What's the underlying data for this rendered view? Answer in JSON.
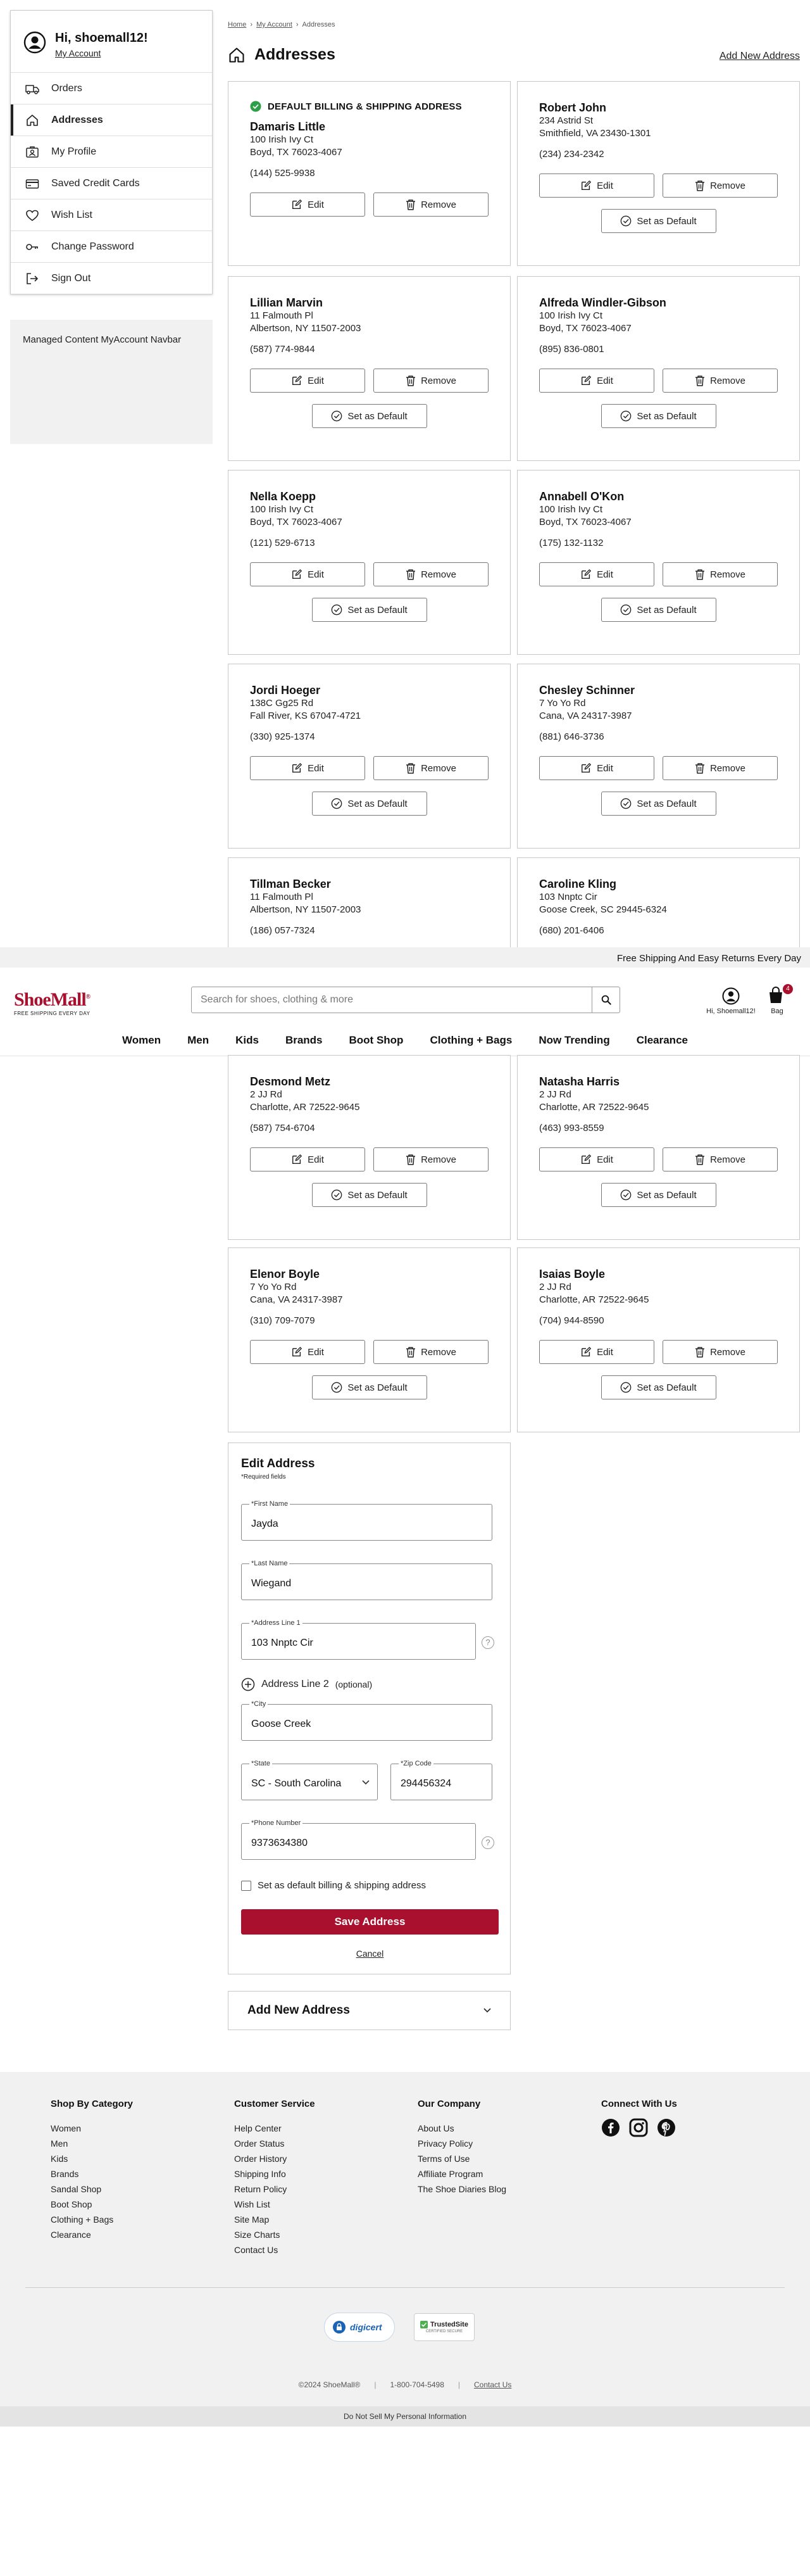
{
  "account": {
    "greeting": "Hi, shoemall12!",
    "my_account_link": "My Account",
    "menu": [
      {
        "label": "Orders",
        "icon": "truck-icon",
        "active": false
      },
      {
        "label": "Addresses",
        "icon": "home-icon",
        "active": true
      },
      {
        "label": "My Profile",
        "icon": "profile-icon",
        "active": false
      },
      {
        "label": "Saved Credit Cards",
        "icon": "credit-card-icon",
        "active": false
      },
      {
        "label": "Wish List",
        "icon": "heart-icon",
        "active": false
      },
      {
        "label": "Change Password",
        "icon": "key-icon",
        "active": false
      },
      {
        "label": "Sign Out",
        "icon": "sign-out-icon",
        "active": false
      }
    ],
    "managed_content": "Managed Content MyAccount Navbar"
  },
  "breadcrumb": [
    "Home",
    "My Account",
    "Addresses"
  ],
  "page": {
    "title": "Addresses",
    "add_new_link": "Add New Address"
  },
  "default_label": "DEFAULT BILLING & SHIPPING ADDRESS",
  "labels": {
    "edit": "Edit",
    "remove": "Remove",
    "set_default": "Set as Default"
  },
  "addresses": [
    {
      "name": "Damaris Little",
      "line1": "100 Irish Ivy Ct",
      "line2": "Boyd, TX 76023-4067",
      "phone": "(144) 525-9938",
      "is_default": true
    },
    {
      "name": "Robert John",
      "line1": "234 Astrid St",
      "line2": "Smithfield, VA 23430-1301",
      "phone": "(234) 234-2342",
      "is_default": false
    },
    {
      "name": "Lillian Marvin",
      "line1": "11 Falmouth Pl",
      "line2": "Albertson, NY 11507-2003",
      "phone": "(587) 774-9844",
      "is_default": false
    },
    {
      "name": "Alfreda Windler-Gibson",
      "line1": "100 Irish Ivy Ct",
      "line2": "Boyd, TX 76023-4067",
      "phone": "(895) 836-0801",
      "is_default": false
    },
    {
      "name": "Nella Koepp",
      "line1": "100 Irish Ivy Ct",
      "line2": "Boyd, TX 76023-4067",
      "phone": "(121) 529-6713",
      "is_default": false
    },
    {
      "name": "Annabell O'Kon",
      "line1": "100 Irish Ivy Ct",
      "line2": "Boyd, TX 76023-4067",
      "phone": "(175) 132-1132",
      "is_default": false
    },
    {
      "name": "Jordi Hoeger",
      "line1": "138C Gg25 Rd",
      "line2": "Fall River, KS 67047-4721",
      "phone": "(330) 925-1374",
      "is_default": false
    },
    {
      "name": "Chesley Schinner",
      "line1": "7 Yo Yo Rd",
      "line2": "Cana, VA 24317-3987",
      "phone": "(881) 646-3736",
      "is_default": false
    },
    {
      "name": "Tillman Becker",
      "line1": "11 Falmouth Pl",
      "line2": "Albertson, NY 11507-2003",
      "phone": "(186) 057-7324",
      "is_default": false
    },
    {
      "name": "Caroline Kling",
      "line1": "103 Nnptc Cir",
      "line2": "Goose Creek, SC 29445-6324",
      "phone": "(680) 201-6406",
      "is_default": false
    },
    {
      "name": "Desmond Metz",
      "line1": "2 JJ Rd",
      "line2": "Charlotte, AR 72522-9645",
      "phone": "(587) 754-6704",
      "is_default": false
    },
    {
      "name": "Natasha Harris",
      "line1": "2 JJ Rd",
      "line2": "Charlotte, AR 72522-9645",
      "phone": "(463) 993-8559",
      "is_default": false
    },
    {
      "name": "Elenor Boyle",
      "line1": "7 Yo Yo Rd",
      "line2": "Cana, VA 24317-3987",
      "phone": "(310) 709-7079",
      "is_default": false
    },
    {
      "name": "Isaias Boyle",
      "line1": "2 JJ Rd",
      "line2": "Charlotte, AR 72522-9645",
      "phone": "(704) 944-8590",
      "is_default": false
    }
  ],
  "promo": "Free Shipping And Easy Returns Every Day",
  "header": {
    "logo": "ShoeMall",
    "logo_reg": "®",
    "logo_tagline": "FREE SHIPPING EVERY DAY",
    "search_placeholder": "Search for shoes, clothing & more",
    "account_label": "Hi, Shoemall12!",
    "bag_label": "Bag",
    "bag_count": "4",
    "nav": [
      "Women",
      "Men",
      "Kids",
      "Brands",
      "Boot Shop",
      "Clothing + Bags",
      "Now Trending",
      "Clearance"
    ]
  },
  "edit_form": {
    "title": "Edit Address",
    "required_note": "*Required fields",
    "first_name_label": "*First Name",
    "first_name": "Jayda",
    "last_name_label": "*Last Name",
    "last_name": "Wiegand",
    "address1_label": "*Address Line 1",
    "address1": "103 Nnptc Cir",
    "address2_toggle": "Address Line 2",
    "address2_optional": "(optional)",
    "city_label": "*City",
    "city": "Goose Creek",
    "state_label": "*State",
    "state": "SC - South Carolina",
    "zip_label": "*Zip Code",
    "zip": "294456324",
    "phone_label": "*Phone Number",
    "phone": "9373634380",
    "default_checkbox": "Set as default billing & shipping address",
    "save": "Save Address",
    "cancel": "Cancel",
    "help_glyph": "?"
  },
  "add_new_panel": "Add New Address",
  "footer": {
    "columns": [
      {
        "title": "Shop By Category",
        "links": [
          "Women",
          "Men",
          "Kids",
          "Brands",
          "Sandal Shop",
          "Boot Shop",
          "Clothing + Bags",
          "Clearance"
        ]
      },
      {
        "title": "Customer Service",
        "links": [
          "Help Center",
          "Order Status",
          "Order History",
          "Shipping Info",
          "Return Policy",
          "Wish List",
          "Site Map",
          "Size Charts",
          "Contact Us"
        ]
      },
      {
        "title": "Our Company",
        "links": [
          "About Us",
          "Privacy Policy",
          "Terms of Use",
          "Affiliate Program",
          "The Shoe Diaries Blog"
        ]
      }
    ],
    "connect_title": "Connect With Us",
    "social_icons": [
      "facebook-icon",
      "instagram-icon",
      "pinterest-icon"
    ],
    "cert_digicert": "digicert",
    "cert_trustedsite": "TrustedSite",
    "cert_trustedsite_sub": "CERTIFIED SECURE",
    "copyright": "©2024 ShoeMall®",
    "phone": "1-800-704-5498",
    "contact": "Contact Us",
    "do_not_sell": "Do Not Sell My Personal Information"
  },
  "colors": {
    "brand": "#a8102e",
    "check_green": "#2e9e48",
    "footer_bg": "#f1f1f1"
  }
}
